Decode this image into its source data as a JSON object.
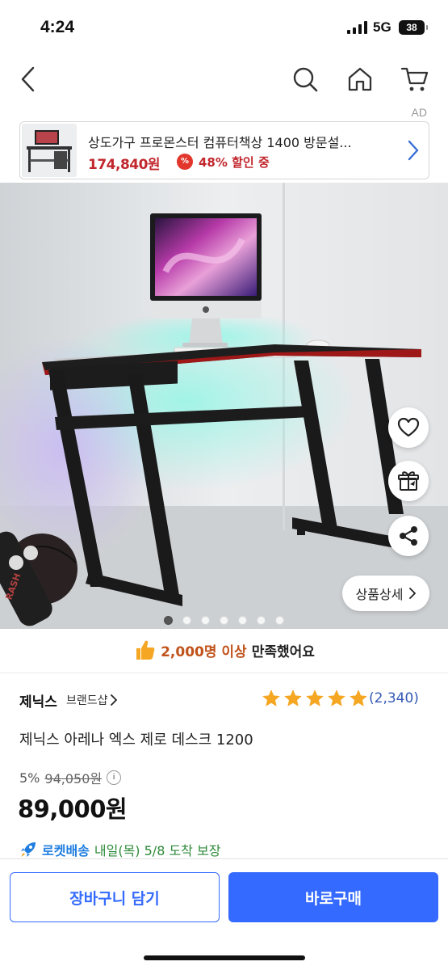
{
  "status_bar": {
    "time": "4:24",
    "network": "5G",
    "battery": "38"
  },
  "nav": {
    "back_icon": "chevron-left-icon",
    "search_icon": "search-icon",
    "home_icon": "home-icon",
    "cart_icon": "cart-icon"
  },
  "ad": {
    "label": "AD",
    "title": "상도가구 프로몬스터 컴퓨터책상 1400 방문설...",
    "price": "174,840원",
    "discount_badge": "%",
    "discount_text": "48% 할인 중"
  },
  "gallery": {
    "image_count": 7,
    "current_index": 0,
    "actions": [
      "heart-icon",
      "gift-icon",
      "share-icon"
    ],
    "detail_button": "상품상세"
  },
  "satisfaction": {
    "highlight": "2,000명 이상",
    "text": "만족했어요"
  },
  "product": {
    "brand": "제닉스",
    "brand_shop": "브랜드샵",
    "rating_stars": 5,
    "review_count": "(2,340)",
    "name": "제닉스 아레나 엑스 제로 데스크 1200",
    "discount_rate": "5%",
    "original_price": "94,050원",
    "price": "89,000원"
  },
  "delivery": {
    "badge": "로켓배송",
    "text": "내일(목) 5/8 도착 보장"
  },
  "actions": {
    "add_to_cart": "장바구니 담기",
    "buy_now": "바로구매"
  },
  "colors": {
    "accent": "#346aff",
    "sale_red": "#c1272d",
    "star": "#f5a623",
    "rocket_blue": "#1f7de0",
    "arrival_green": "#2e8a3a"
  }
}
